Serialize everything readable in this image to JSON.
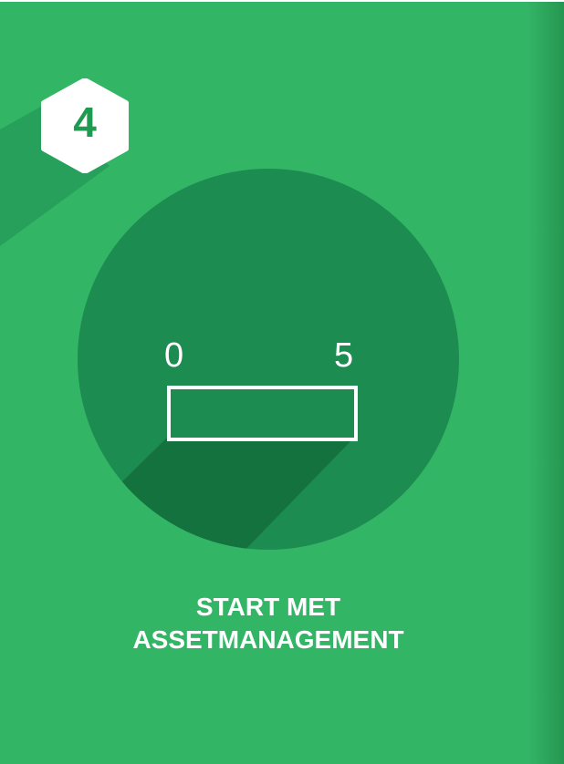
{
  "card": {
    "step_number": "4",
    "scale": {
      "min_label": "0",
      "max_label": "5",
      "progress": 0
    },
    "title_line1": "START MET",
    "title_line2": "ASSETMANAGEMENT"
  },
  "colors": {
    "background": "#33b566",
    "circle": "#1d8c51",
    "circle_shadow": "#13723d",
    "badge_number": "#1f9a50",
    "text": "#ffffff"
  },
  "icons": {
    "badge": "hexagon-icon"
  }
}
